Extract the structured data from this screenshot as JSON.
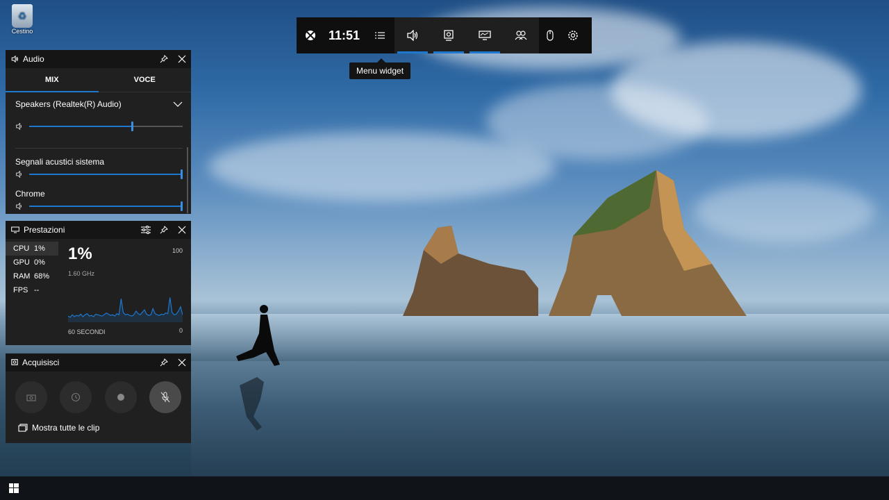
{
  "desktop": {
    "recycle_bin_label": "Cestino"
  },
  "gamebar": {
    "time": "11:51",
    "tooltip": "Menu widget",
    "buttons": [
      "xbox-icon",
      "widget-menu-icon",
      "audio-icon",
      "capture-icon",
      "performance-icon",
      "social-icon",
      "mouse-icon",
      "settings-icon"
    ]
  },
  "audio": {
    "title": "Audio",
    "tabs": [
      "MIX",
      "VOCE"
    ],
    "active_tab": "MIX",
    "device": "Speakers (Realtek(R) Audio)",
    "master_volume_pct": 67,
    "apps": [
      {
        "name": "Segnali acustici sistema",
        "volume_pct": 100
      },
      {
        "name": "Chrome",
        "volume_pct": 100
      }
    ]
  },
  "performance": {
    "title": "Prestazioni",
    "metrics": [
      {
        "key": "CPU",
        "value": "1%"
      },
      {
        "key": "GPU",
        "value": "0%"
      },
      {
        "key": "RAM",
        "value": "68%"
      },
      {
        "key": "FPS",
        "value": "--"
      }
    ],
    "big_value": "1%",
    "frequency": "1.60 GHz",
    "max_label": "100",
    "min_label": "0",
    "time_label": "60 SECONDI",
    "cpu_history": [
      10,
      8,
      12,
      9,
      11,
      10,
      13,
      9,
      12,
      14,
      10,
      11,
      9,
      13,
      12,
      11,
      10,
      12,
      15,
      13,
      11,
      12,
      10,
      14,
      12,
      38,
      16,
      12,
      13,
      11,
      10,
      12,
      18,
      14,
      12,
      16,
      20,
      13,
      11,
      12,
      22,
      14,
      12,
      11,
      13,
      12,
      15,
      14,
      40,
      16,
      12,
      13,
      18,
      25,
      12
    ]
  },
  "capture": {
    "title": "Acquisisci",
    "show_clips": "Mostra tutte le clip"
  },
  "colors": {
    "accent": "#1e78d0",
    "panel": "#202020",
    "header": "#151515"
  }
}
